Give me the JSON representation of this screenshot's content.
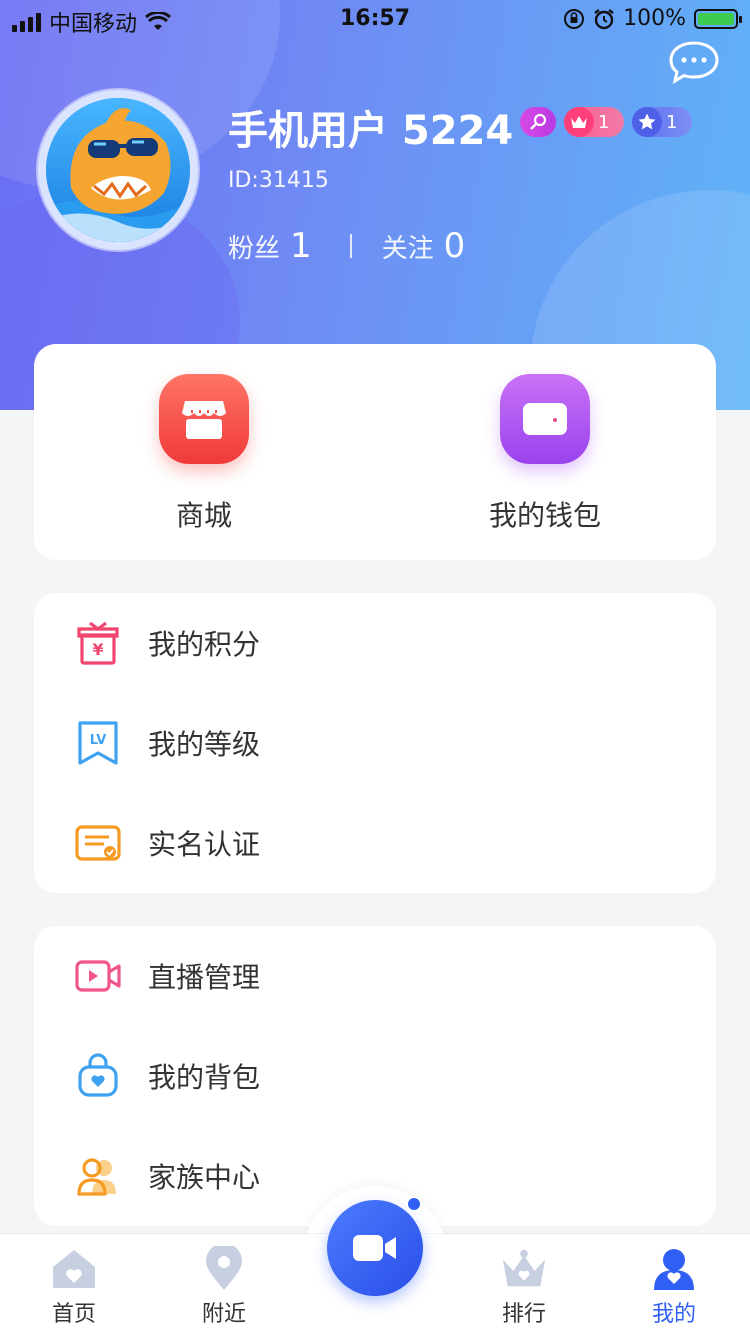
{
  "status_bar": {
    "carrier": "中国移动",
    "time": "16:57",
    "battery": "100%"
  },
  "profile": {
    "username": "手机用户 5224",
    "id": "ID:31415",
    "badges": [
      {
        "icon": "search-badge-icon",
        "value": ""
      },
      {
        "icon": "crown-badge-icon",
        "value": "1"
      },
      {
        "icon": "star-badge-icon",
        "value": "1"
      }
    ],
    "fans_label": "粉丝",
    "fans_count": "1",
    "follow_label": "关注",
    "follow_count": "0"
  },
  "quick_actions": [
    {
      "label": "商城",
      "icon": "shop-icon",
      "color": "#f5514c"
    },
    {
      "label": "我的钱包",
      "icon": "wallet-icon",
      "color": "#a24ff0"
    }
  ],
  "menu_group_1": [
    {
      "label": "我的积分",
      "icon": "points-gift-icon",
      "color": "#f0456d"
    },
    {
      "label": "我的等级",
      "icon": "level-lv-icon",
      "color": "#3fa2f0"
    },
    {
      "label": "实名认证",
      "icon": "verify-certificate-icon",
      "color": "#f59a23"
    }
  ],
  "menu_group_2": [
    {
      "label": "直播管理",
      "icon": "live-camera-icon",
      "color": "#f0558e"
    },
    {
      "label": "我的背包",
      "icon": "backpack-icon",
      "color": "#3fa2f0"
    },
    {
      "label": "家族中心",
      "icon": "family-users-icon",
      "color": "#f59a23"
    }
  ],
  "tab_bar": {
    "tabs": [
      {
        "label": "首页",
        "icon": "home-icon"
      },
      {
        "label": "附近",
        "icon": "location-pin-icon"
      },
      {
        "label": "排行",
        "icon": "crown-rank-icon"
      },
      {
        "label": "我的",
        "icon": "me-user-icon"
      }
    ],
    "active": "我的",
    "center_icon": "video-camera-icon"
  },
  "colors": {
    "accent": "#2f5ff5",
    "header_start": "#6a6cf3",
    "header_end": "#5fb4f7"
  }
}
